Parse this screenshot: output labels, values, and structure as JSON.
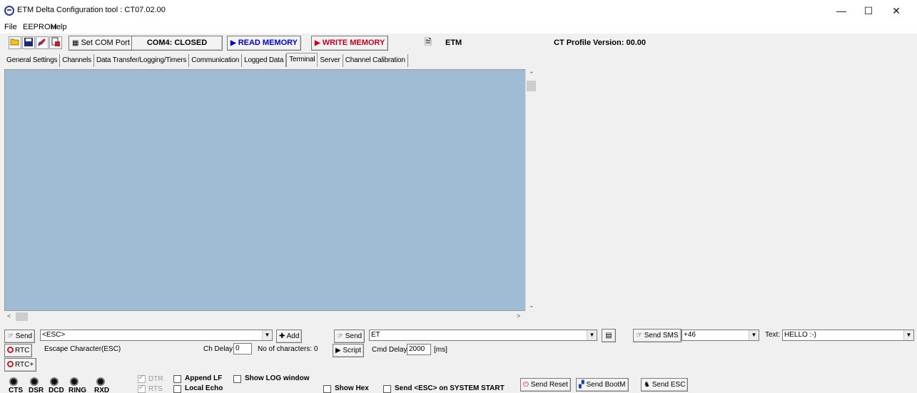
{
  "window": {
    "title": "ETM Delta Configuration tool : CT07.02.00",
    "minimize": "—",
    "maximize": "☐",
    "close": "✕"
  },
  "menu": [
    "File",
    "EEPROM",
    "Help"
  ],
  "toolbar": {
    "set_com_port": "Set COM Port",
    "com_status": "COM4: CLOSED",
    "read_memory": "READ MEMORY",
    "write_memory": "WRITE MEMORY",
    "etm": "ETM",
    "profile_version": "CT Profile Version: 00.00"
  },
  "tabs": [
    "General Settings",
    "Channels",
    "Data Transfer/Logging/Timers",
    "Communication",
    "Logged Data",
    "Terminal",
    "Server",
    "Channel Calibration"
  ],
  "active_tab": "Terminal",
  "terminal": {
    "send_label": "Send",
    "command_value": "<ESC>",
    "add_label": "Add",
    "escape_desc": "Escape Character(ESC)",
    "ch_delay_label": "Ch Delay:",
    "ch_delay_value": "0",
    "num_chars": "No of characters: 0",
    "rtc_label": "RTC",
    "rtc_plus_label": "RTC+",
    "send2_label": "Send",
    "command2_value": "ET",
    "script_label": "Script",
    "cmd_delay_label": "Cmd Delay:",
    "cmd_delay_value": "2000",
    "cmd_delay_unit": "[ms]",
    "send_sms_label": "Send SMS",
    "sms_number": "+46",
    "text_label": "Text:",
    "sms_text": "HELLO :-)"
  },
  "signals": [
    "CTS",
    "DSR",
    "DCD",
    "RING",
    "RXD"
  ],
  "options": {
    "dtr": "DTR",
    "rts": "RTS",
    "append_lf": "Append LF",
    "local_echo": "Local Echo",
    "show_log": "Show LOG window",
    "show_hex": "Show Hex",
    "send_esc_start": "Send <ESC> on SYSTEM START",
    "send_reset": "Send Reset",
    "send_bootm": "Send BootM",
    "send_esc": "Send ESC"
  },
  "colors": {
    "terminal_bg": "#a0bcd4",
    "read_memory": "#0000c8",
    "write_memory": "#c8001e"
  }
}
